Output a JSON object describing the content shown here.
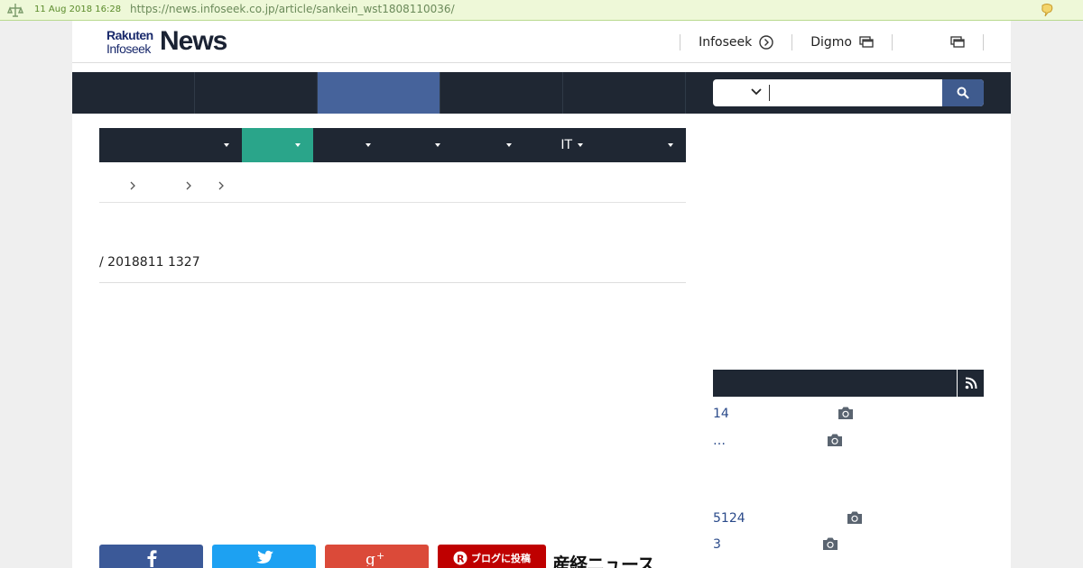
{
  "archive": {
    "date": "11 Aug 2018 16:28",
    "url": "https://news.infoseek.co.jp/article/sankein_wst1808110036/"
  },
  "brand": {
    "line1": "Rakuten",
    "line2": "Infoseek",
    "news": "News"
  },
  "header_links": [
    {
      "label": "Infoseek",
      "icon": "circle-arrow-icon"
    },
    {
      "label": "Digmo",
      "icon": "windows-icon"
    },
    {
      "label": "",
      "icon": "windows-icon"
    }
  ],
  "main_nav": {
    "active_index": 2,
    "tab_count": 5
  },
  "search": {
    "selected": "",
    "placeholder": ""
  },
  "categories": [
    {
      "label": "",
      "active": false
    },
    {
      "label": "",
      "active": true
    },
    {
      "label": "",
      "active": false
    },
    {
      "label": "",
      "active": false
    },
    {
      "label": "",
      "active": false
    },
    {
      "label": "IT",
      "active": false
    },
    {
      "label": "",
      "active": false
    }
  ],
  "article": {
    "meta": "/ 2018811 1327"
  },
  "share": {
    "blog_label": "ブログに投稿",
    "sankei_label": "産経ニュース"
  },
  "sidebar": {
    "title": "",
    "ranking": [
      {
        "text": "14"
      },
      {
        "text": "…"
      },
      {
        "text": "5124"
      },
      {
        "text": "3"
      }
    ]
  },
  "colors": {
    "nav_dark": "#1f2733",
    "nav_active": "#46639b",
    "category_active": "#2aa58a",
    "facebook": "#3b5998",
    "twitter": "#1da1f2",
    "google_plus": "#db4a39",
    "blog": "#bf0000",
    "link": "#2a4a8a"
  }
}
